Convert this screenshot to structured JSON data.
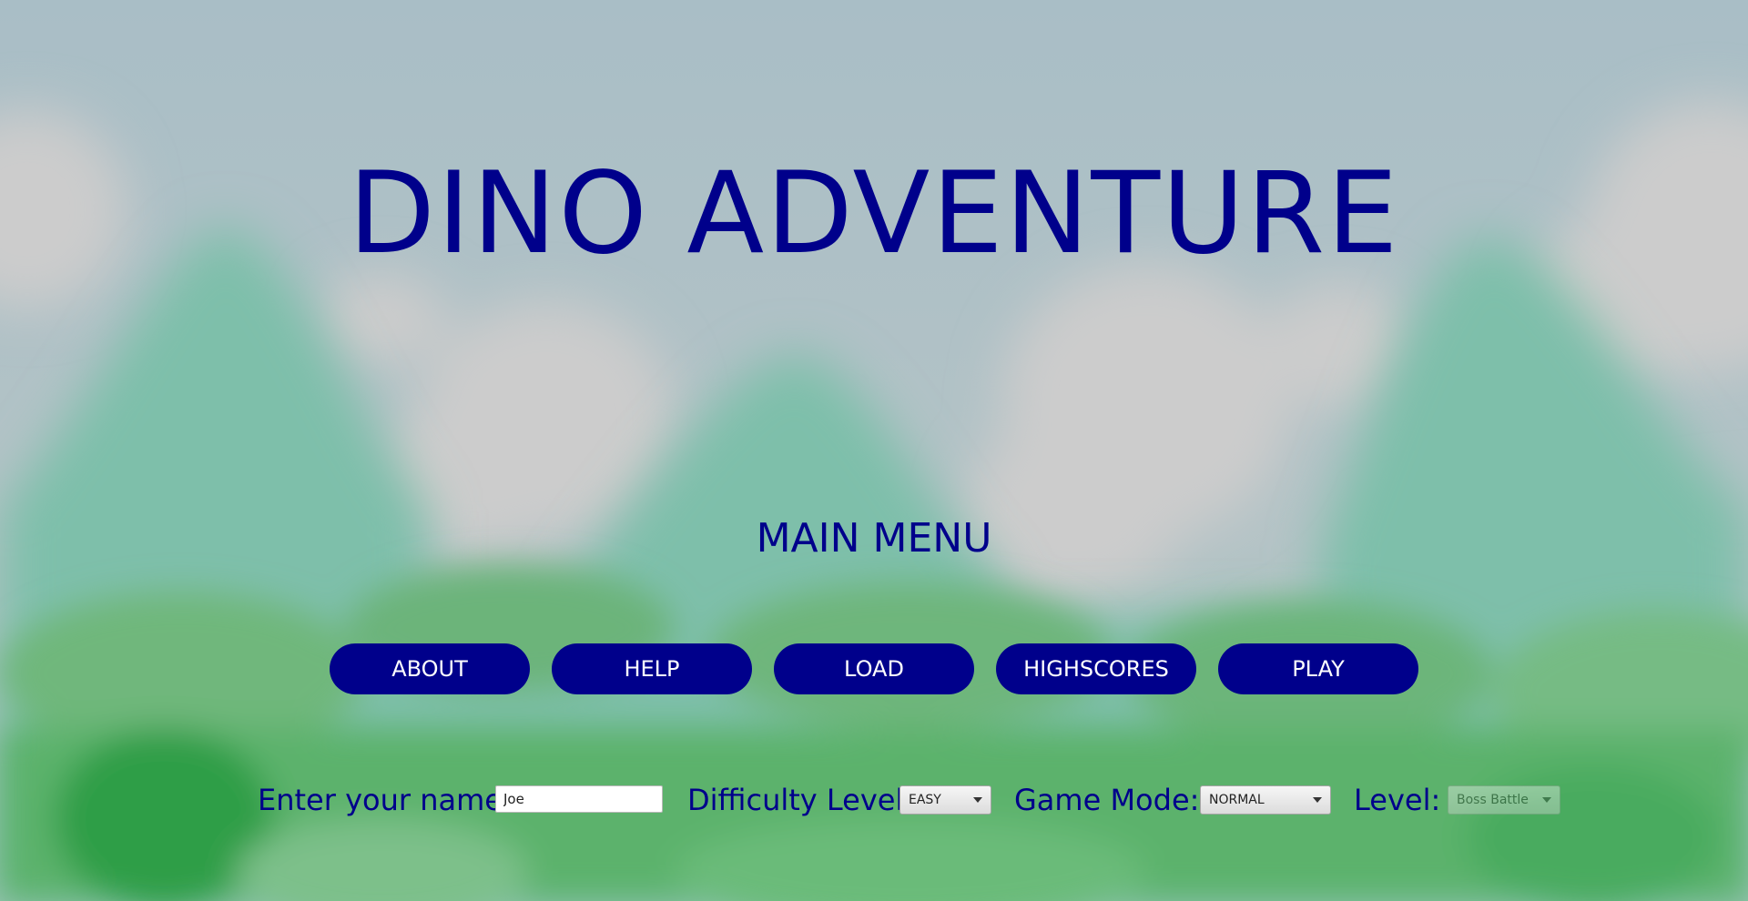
{
  "game": {
    "title": "DINO ADVENTURE",
    "menu_heading": "MAIN MENU"
  },
  "menu_buttons": {
    "about": "ABOUT",
    "help": "HELP",
    "load": "LOAD",
    "highscores": "HIGHSCORES",
    "play": "PLAY"
  },
  "options": {
    "name_label": "Enter your name:",
    "name_value": "Joe",
    "difficulty_label": "Difficulty Level:",
    "difficulty_value": "EASY",
    "mode_label": "Game Mode:",
    "mode_value": "NORMAL",
    "level_label": "Level:",
    "level_value": "Boss Battle",
    "level_enabled": false
  },
  "colors": {
    "accent": "#00008b",
    "button_text": "#ffffff",
    "sky": "#a9bfc7",
    "cloud": "#cbcbcb",
    "mountain": "#7fbfa8",
    "ground": "#5fb36e"
  }
}
